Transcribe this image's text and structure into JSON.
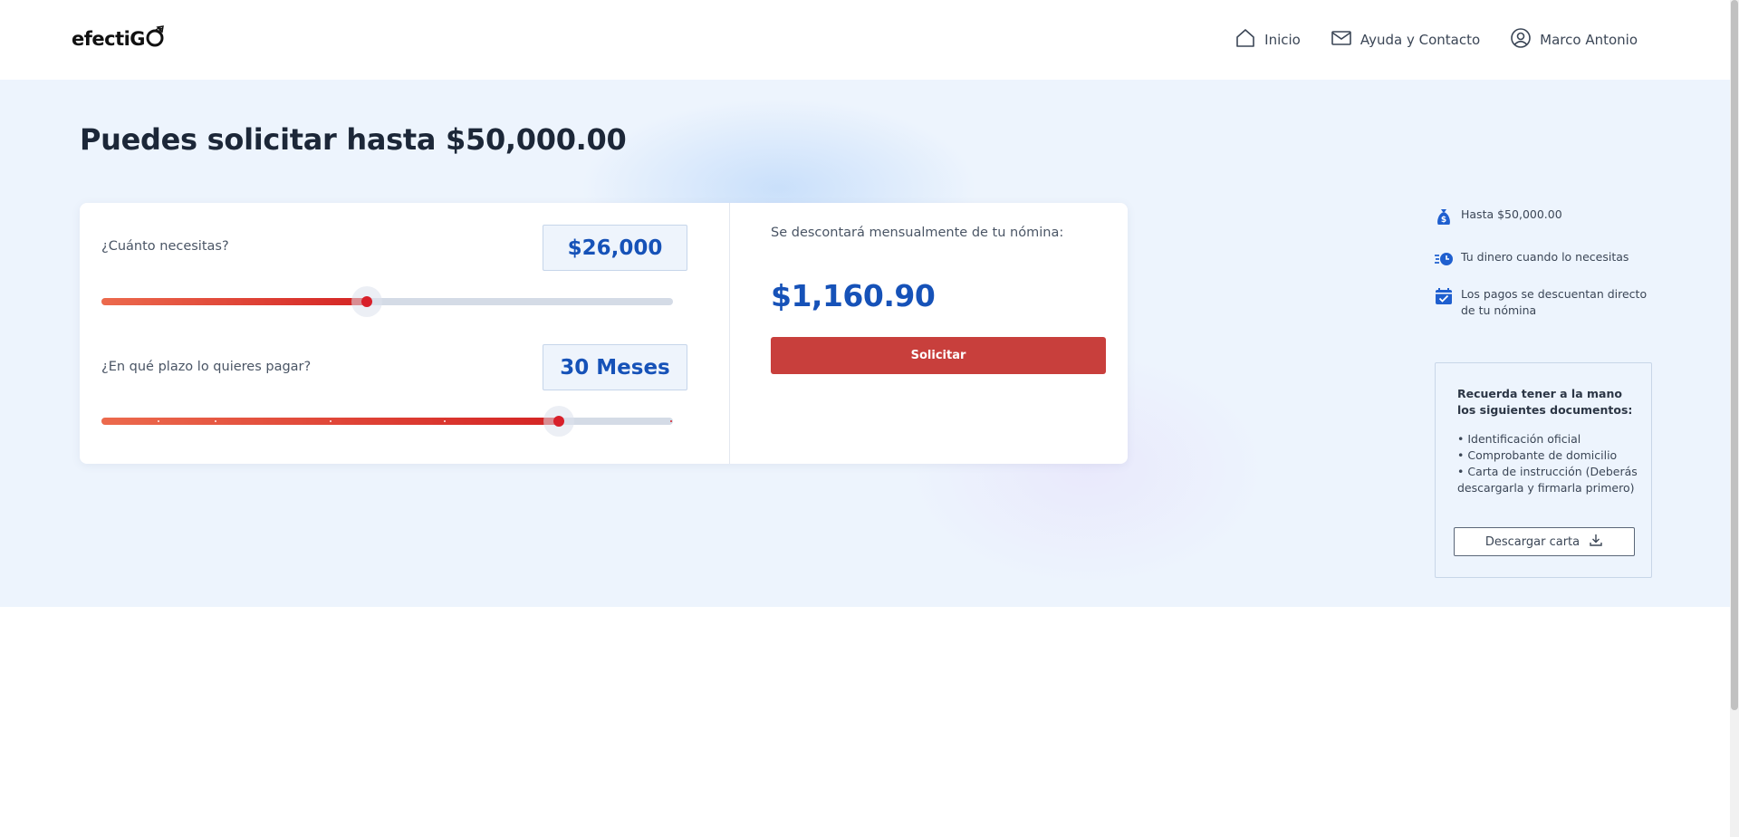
{
  "header": {
    "logo_text": "efectiG",
    "logo_mark": "logo-mark-icon",
    "nav": [
      {
        "label": "Inicio",
        "icon": "home-icon"
      },
      {
        "label": "Ayuda y Contacto",
        "icon": "mail-icon"
      },
      {
        "label": "Marco Antonio",
        "icon": "user-icon"
      }
    ]
  },
  "hero": {
    "title": "Puedes solicitar hasta $50,000.00"
  },
  "simulator": {
    "amount_question": "¿Cuánto necesitas?",
    "amount_value": "$26,000",
    "amount_slider_fraction": 0.465,
    "term_question": "¿En qué plazo lo quieres pagar?",
    "term_value": "30 Meses",
    "term_slider_fraction": 0.8,
    "deduction_text": "Se descontará mensualmente de tu nómina:",
    "monthly_payment": "$1,160.90",
    "submit_label": "Solicitar"
  },
  "benefits": [
    {
      "icon": "money-bag-icon",
      "text": "Hasta $50,000.00"
    },
    {
      "icon": "fast-clock-icon",
      "text": "Tu dinero cuando lo necesitas"
    },
    {
      "icon": "calendar-check-icon",
      "text": "Los pagos se descuentan directo de tu nómina"
    }
  ],
  "documents": {
    "title": "Recuerda tener a la mano los siguientes documentos:",
    "items": [
      "Identificación oficial",
      "Comprobante de domicilio",
      "Carta de instrucción (Deberás descargarla y firmarla primero)"
    ],
    "download_label": "Descargar carta"
  },
  "colors": {
    "accent_blue": "#1652b8",
    "accent_red": "#c83f3c",
    "band_background": "#edf4fd"
  }
}
